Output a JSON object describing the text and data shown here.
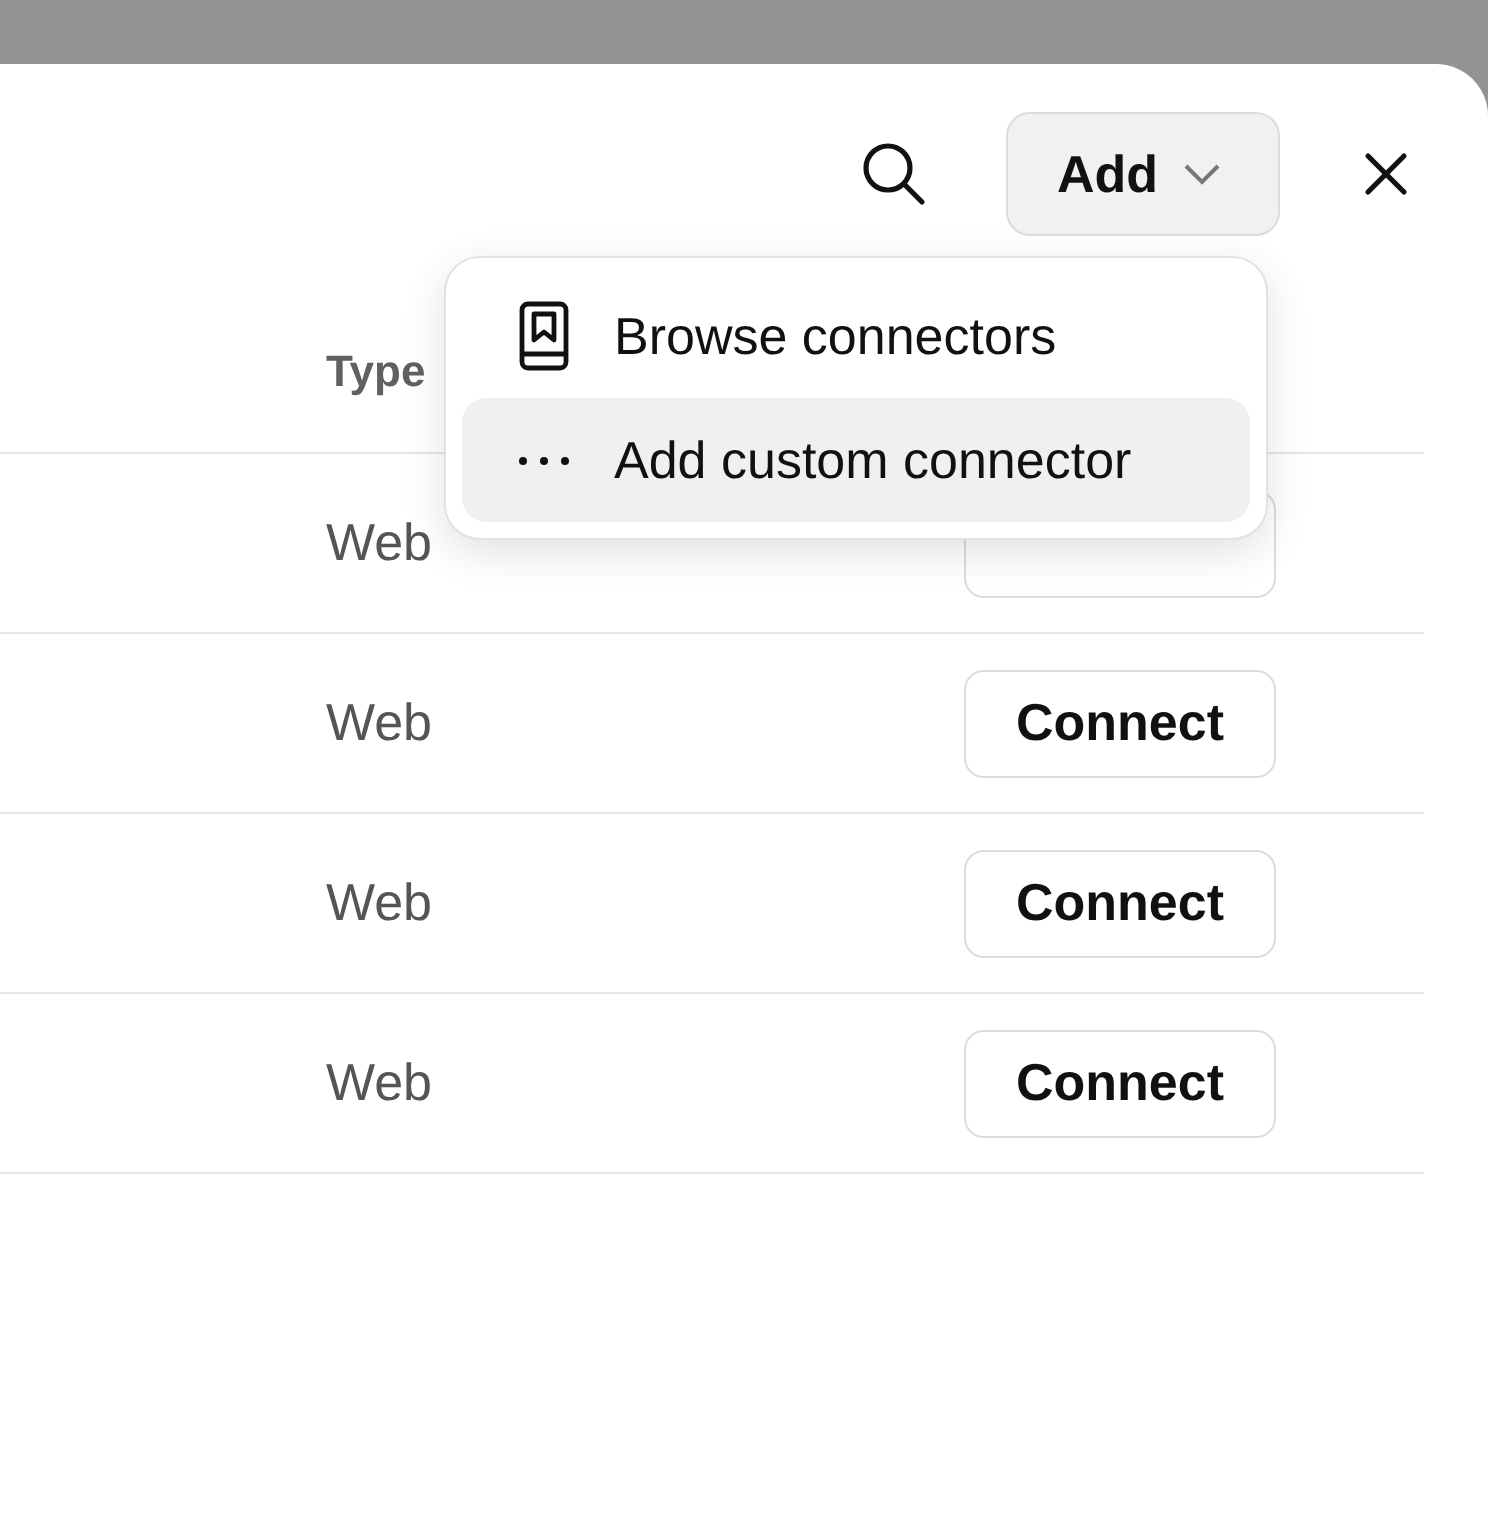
{
  "toolbar": {
    "add_button": "Add"
  },
  "table": {
    "columns": [
      "Type"
    ],
    "rows": [
      {
        "type": "Web"
      },
      {
        "type": "Web",
        "action": "Connect"
      },
      {
        "type": "Web",
        "action": "Connect"
      },
      {
        "type": "Web",
        "action": "Connect"
      }
    ]
  },
  "add_menu": [
    {
      "kind": "book",
      "label": "Browse connectors",
      "selected": false
    },
    {
      "kind": "more",
      "label": "Add custom connector",
      "selected": true
    }
  ]
}
